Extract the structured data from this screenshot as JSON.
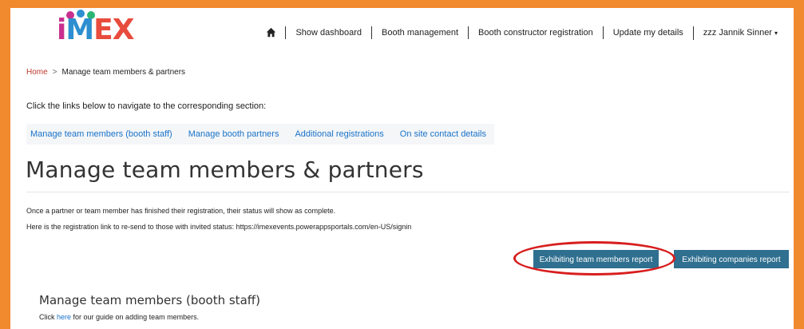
{
  "logo": {
    "text": [
      "i",
      "M",
      "E",
      "X"
    ],
    "colors": [
      "#c9308e",
      "#2e8fd0",
      "#e84c3d",
      "#e84c3d"
    ],
    "dot_colors": [
      "#c9308e",
      "#2e8fd0",
      "#2bb673"
    ]
  },
  "nav": {
    "home_icon": "home-icon",
    "items": [
      "Show dashboard",
      "Booth management",
      "Booth constructor registration",
      "Update my details",
      "zzz Jannik Sinner"
    ],
    "user_caret": "▾"
  },
  "breadcrumb": {
    "home": "Home",
    "separator": ">",
    "current": "Manage team members & partners"
  },
  "intro": "Click the links below to navigate to the corresponding section:",
  "section_links": [
    "Manage team members (booth staff)",
    "Manage booth partners",
    "Additional registrations",
    "On site contact details"
  ],
  "title": "Manage team members & partners",
  "notes": [
    "Once a partner or team member has finished their registration, their status will show as complete.",
    "Here is the registration link to re-send to those with invited status: https://imexevents.powerappsportals.com/en-US/signin"
  ],
  "buttons": {
    "team_report": "Exhibiting team members report",
    "companies_report": "Exhibiting companies report"
  },
  "subsection": {
    "title": "Manage team members (booth staff)",
    "guide_prefix": "Click ",
    "guide_link": "here",
    "guide_suffix": " for our guide on adding team members."
  },
  "colors": {
    "frame": "#f1892f",
    "button": "#2f6f8f",
    "link": "#1a73c8",
    "annotation": "#d81e1e"
  }
}
